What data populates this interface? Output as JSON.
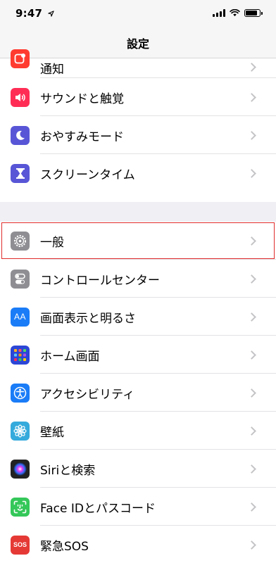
{
  "status": {
    "time": "9:47"
  },
  "nav": {
    "title": "設定"
  },
  "section1": [
    {
      "label": "通知",
      "icon": "notifications-icon",
      "color": "#ff3b30"
    },
    {
      "label": "サウンドと触覚",
      "icon": "speaker-icon",
      "color": "#ff2d55"
    },
    {
      "label": "おやすみモード",
      "icon": "moon-icon",
      "color": "#5856d6"
    },
    {
      "label": "スクリーンタイム",
      "icon": "hourglass-icon",
      "color": "#5856d6"
    }
  ],
  "section2": [
    {
      "label": "一般",
      "icon": "gear-icon",
      "color": "#8e8e93",
      "highlighted": true
    },
    {
      "label": "コントロールセンター",
      "icon": "toggles-icon",
      "color": "#8e8e93"
    },
    {
      "label": "画面表示と明るさ",
      "icon": "text-size-icon",
      "color": "#1a7cf7",
      "icon_text": "AA"
    },
    {
      "label": "ホーム画面",
      "icon": "app-grid-icon",
      "color": "#2c46d6"
    },
    {
      "label": "アクセシビリティ",
      "icon": "accessibility-icon",
      "color": "#1a7cf7"
    },
    {
      "label": "壁紙",
      "icon": "flower-icon",
      "color": "#35aadc"
    },
    {
      "label": "Siriと検索",
      "icon": "siri-icon",
      "color": "#222222"
    },
    {
      "label": "Face IDとパスコード",
      "icon": "face-id-icon",
      "color": "#34c759"
    },
    {
      "label": "緊急SOS",
      "icon": "sos-icon",
      "color": "#e53935",
      "icon_text": "SOS"
    }
  ]
}
